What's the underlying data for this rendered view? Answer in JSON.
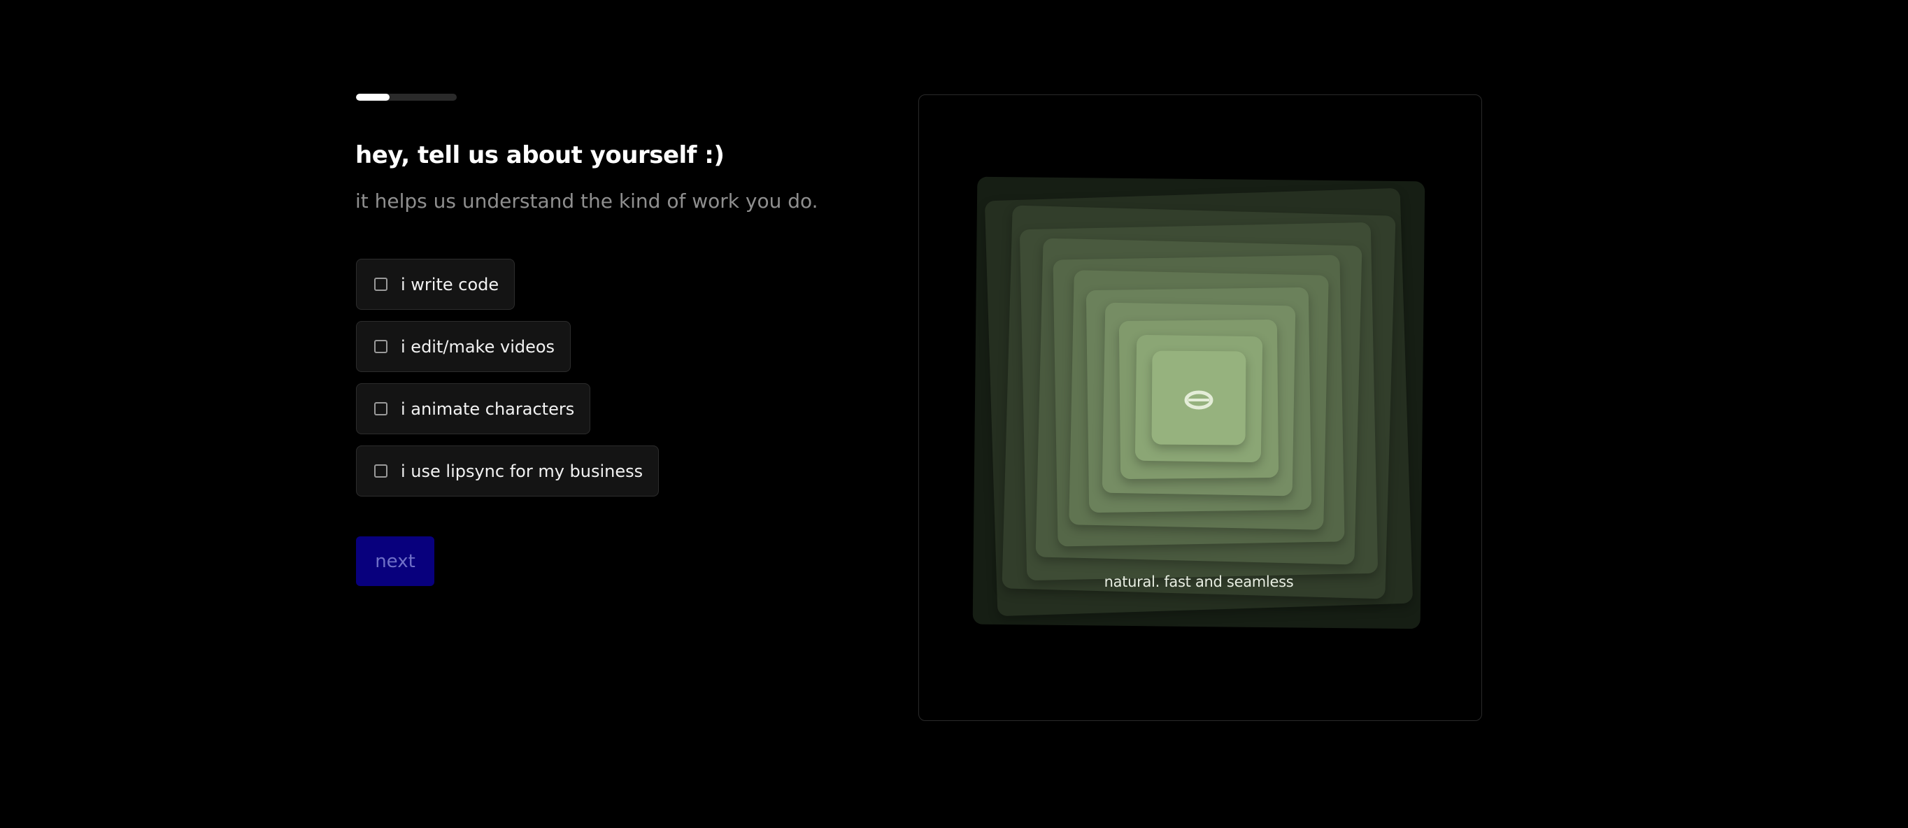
{
  "progress": {
    "fraction": 0.33,
    "track_color": "#2a2a2a",
    "fill_color": "#ffffff"
  },
  "header": {
    "title": "hey, tell us about yourself :)",
    "subtitle": "it helps us understand the kind of work you do."
  },
  "options": [
    {
      "label": "i write code",
      "checked": false
    },
    {
      "label": "i edit/make videos",
      "checked": false
    },
    {
      "label": "i animate characters",
      "checked": false
    },
    {
      "label": "i use lipsync for my business",
      "checked": false
    }
  ],
  "next_button": {
    "label": "next",
    "color": "#08007d"
  },
  "preview": {
    "tagline": "natural. fast and seamless",
    "icon": "ring-icon",
    "accent": "#8aa576"
  }
}
